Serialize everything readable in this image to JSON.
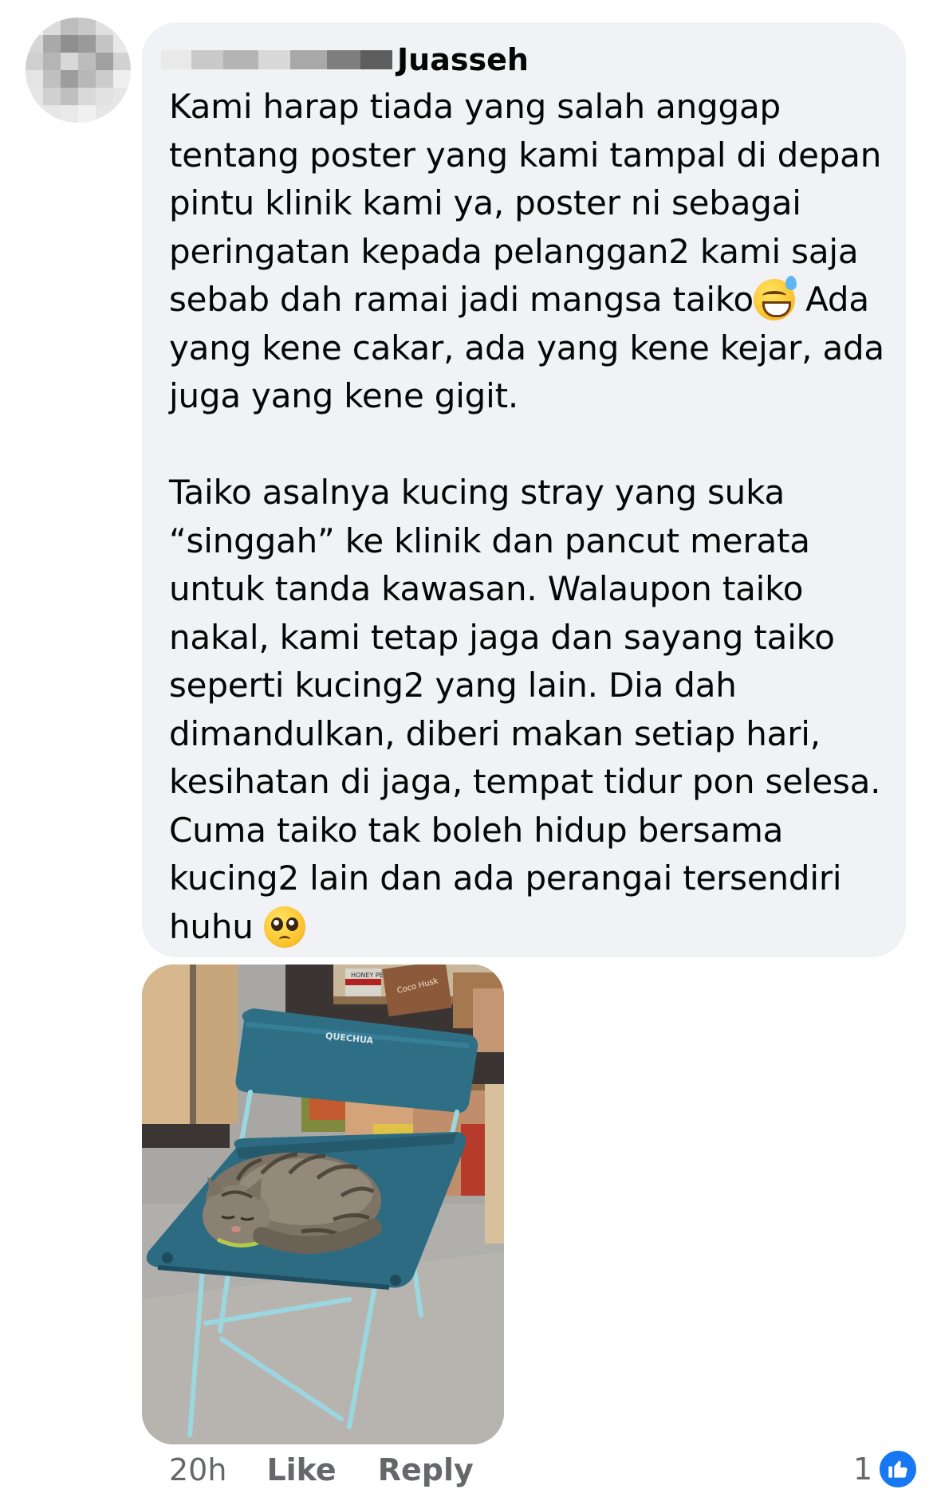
{
  "comment": {
    "author": {
      "name_visible": "Juasseh"
    },
    "paragraphs": [
      "Kami harap tiada yang salah anggap\ntentang poster yang kami tampal di depan\npintu klinik kami ya, poster ni sebagai\nperingatan kepada pelanggan2 kami saja\nsebab dah ramai jadi mangsa taiko",
      " Ada\nyang kene cakar, ada yang kene kejar, ada\njuga yang kene gigit.",
      "Taiko asalnya kucing stray yang suka\n“singgah” ke klinik dan pancut merata\nuntuk tanda kawasan. Walaupon taiko\nnakal, kami tetap jaga dan sayang taiko\nseperti kucing2 yang lain. Dia dah\ndimandulkan, diberi makan setiap hari,\nkesihatan di jaga, tempat tidur pon selesa.\nCuma taiko tak boleh hidup bersama\nkucing2 lain dan ada perangai tersendiri\nhuhu "
    ],
    "emojis": [
      "sweat-smile-emoji",
      "pleading-face-emoji"
    ],
    "photo": {
      "chair_brand_text": "QUECHUA",
      "product_labels": [
        "HONEY PET",
        "Coco Husk"
      ]
    },
    "meta": {
      "time": "20h",
      "like_label": "Like",
      "reply_label": "Reply",
      "reaction_count": "1",
      "reaction_icon": "like-thumb-icon"
    }
  },
  "colors": {
    "bubble": "#f0f2f5",
    "text": "#050505",
    "meta_text": "#65676b",
    "like_blue": "#1877f2"
  }
}
